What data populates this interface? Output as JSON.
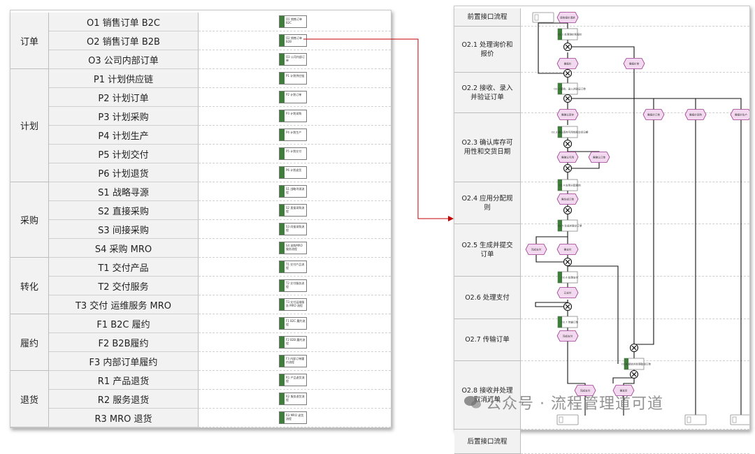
{
  "left_table": {
    "categories": [
      {
        "label": "订单",
        "rows": [
          {
            "label": "O1 销售订单 B2C",
            "chip": "O1 销售订单 B2C"
          },
          {
            "label": "O2 销售订单 B2B",
            "chip": "O2 销售订单 B2B"
          },
          {
            "label": "O3 公司内部订单",
            "chip": "O3 公司内部订单"
          }
        ]
      },
      {
        "label": "计划",
        "rows": [
          {
            "label": "P1 计划供应链",
            "chip": "P1 计划供应链"
          },
          {
            "label": "P2 计划订单",
            "chip": "P2 计划订单"
          },
          {
            "label": "P3 计划采购",
            "chip": "P3 计划采购"
          },
          {
            "label": "P4 计划生产",
            "chip": "P4 计划生产"
          },
          {
            "label": "P5 计划交付",
            "chip": "P5 计划交付"
          },
          {
            "label": "P6 计划退货",
            "chip": "P6 计划退货"
          }
        ]
      },
      {
        "label": "采购",
        "rows": [
          {
            "label": "S1 战略寻源",
            "chip": "S1 战略寻源流程"
          },
          {
            "label": "S2 直接采购",
            "chip": "S2 直接采购流程"
          },
          {
            "label": "S3 间接采购",
            "chip": "S3 间接采购流程"
          },
          {
            "label": "S4 采购 MRO",
            "chip": "S4 采购MRO 服务流程"
          }
        ]
      },
      {
        "label": "转化",
        "rows": [
          {
            "label": "T1 交付产品",
            "chip": "T1 交付产品流程"
          },
          {
            "label": "T2 交付服务",
            "chip": "T2 交付服务流程"
          },
          {
            "label": "T3 交付 运维服务 MRO",
            "chip": "T3 交付运维服务 MRO 流程"
          }
        ]
      },
      {
        "label": "履约",
        "rows": [
          {
            "label": "F1 B2C 履约",
            "chip": "F1 B2C 履约流程"
          },
          {
            "label": "F2 B2B履约",
            "chip": "F2 B2B 履约流程"
          },
          {
            "label": "F3 内部订单履约",
            "chip": "F3 内部订单履约流程"
          }
        ]
      },
      {
        "label": "退货",
        "rows": [
          {
            "label": "R1 产品退货",
            "chip": "R1 产品退货流程"
          },
          {
            "label": "R2 服务退货",
            "chip": "R2 服务退货流程"
          },
          {
            "label": "R3 MRO 退货",
            "chip": "R3 MRO 退货流程"
          }
        ]
      }
    ]
  },
  "right_flow": {
    "lanes": [
      "前置接口流程",
      "O2.1 处理询价和报价",
      "O2.2 接收、录入并验证订单",
      "O2.3 确认库存可用性和交货日期",
      "O2.4 应用分配规则",
      "O2.5 生成并提交订单",
      "O2.6 处理支付",
      "O2.7 传输订单",
      "O2.8 接收并处理取消订单",
      "后置接口流程"
    ],
    "events": [
      "接收报价请求",
      "需报价",
      "需报价单",
      "需确认库存",
      "需报价订单",
      "需报价采购",
      "需报价生产",
      "需确认可用",
      "需确认订单",
      "需生成订单",
      "完成支付",
      "需支付",
      "已支付",
      "完成支付",
      "需发货"
    ],
    "functions": [
      "O2.1 处理询价和报价",
      "O2.2 接收、录入并验证订单",
      "O2.3 确认库存可用性和交货日期",
      "O2.4 应用分配规则",
      "O2.5 生成并提交订单",
      "O2.6 处理支付",
      "O2.7 传输订单",
      "O2.8 接收并处理取消订单"
    ]
  },
  "watermark": "公众号 · 流程管理道可道",
  "colors": {
    "accent_green": "#3e7d3a",
    "event_fill": "#f3d9ef",
    "event_border": "#9c3b8f",
    "arrow": "#c00000",
    "header_fill": "#f2f2f2"
  }
}
